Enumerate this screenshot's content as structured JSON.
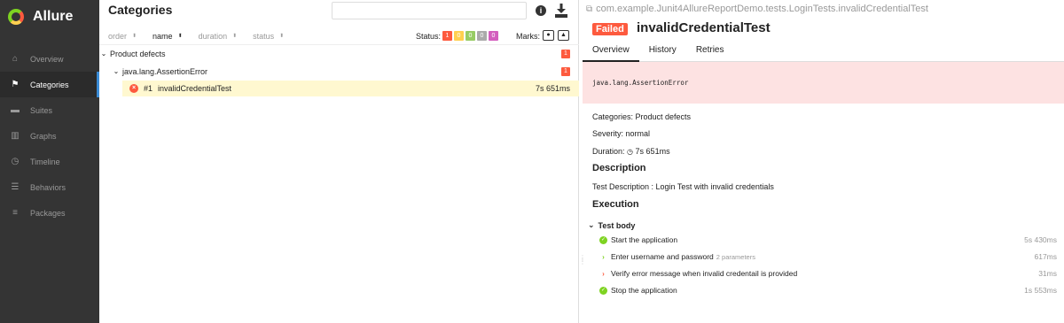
{
  "app": {
    "name": "Allure"
  },
  "sidebar": {
    "items": [
      {
        "label": "Overview",
        "icon": "home-icon"
      },
      {
        "label": "Categories",
        "icon": "flag-icon"
      },
      {
        "label": "Suites",
        "icon": "briefcase-icon"
      },
      {
        "label": "Graphs",
        "icon": "bar-chart-icon"
      },
      {
        "label": "Timeline",
        "icon": "clock-icon"
      },
      {
        "label": "Behaviors",
        "icon": "list-icon"
      },
      {
        "label": "Packages",
        "icon": "align-left-icon"
      }
    ],
    "active": "Categories"
  },
  "tree": {
    "title": "Categories",
    "search_placeholder": "",
    "sort_columns": [
      "order",
      "name",
      "duration",
      "status"
    ],
    "status_label": "Status:",
    "status_counts": [
      "1",
      "0",
      "0",
      "0",
      "0"
    ],
    "status_colors": [
      "#fd5a3e",
      "#ffd050",
      "#97cc64",
      "#aaaaaa",
      "#d35ebe"
    ],
    "marks_label": "Marks:",
    "rows": [
      {
        "label": "Product defects",
        "count": "1"
      },
      {
        "label": "java.lang.AssertionError",
        "count": "1"
      }
    ],
    "leaf": {
      "index": "#1",
      "name": "invalidCredentialTest",
      "duration": "7s 651ms"
    }
  },
  "detail": {
    "breadcrumb": "com.example.Junit4AllureReportDemo.tests.LoginTests.invalidCredentialTest",
    "status": "Failed",
    "title": "invalidCredentialTest",
    "tabs": [
      "Overview",
      "History",
      "Retries"
    ],
    "error": "java.lang.AssertionError",
    "categories": "Categories: Product defects",
    "severity": "Severity: normal",
    "duration_label": "Duration:",
    "duration_value": "7s 651ms",
    "description_h": "Description",
    "description": "Test Description : Login Test with invalid credentials",
    "execution_h": "Execution",
    "test_body": "Test body",
    "steps": [
      {
        "label": "Start the application",
        "params": "",
        "duration": "5s 430ms",
        "state": "passed"
      },
      {
        "label": "Enter username and password",
        "params": "2 parameters",
        "duration": "617ms",
        "state": "expandable"
      },
      {
        "label": "Verify error message when invalid credentail is provided",
        "params": "",
        "duration": "31ms",
        "state": "failed"
      },
      {
        "label": "Stop the application",
        "params": "",
        "duration": "1s 553ms",
        "state": "passed"
      }
    ]
  }
}
